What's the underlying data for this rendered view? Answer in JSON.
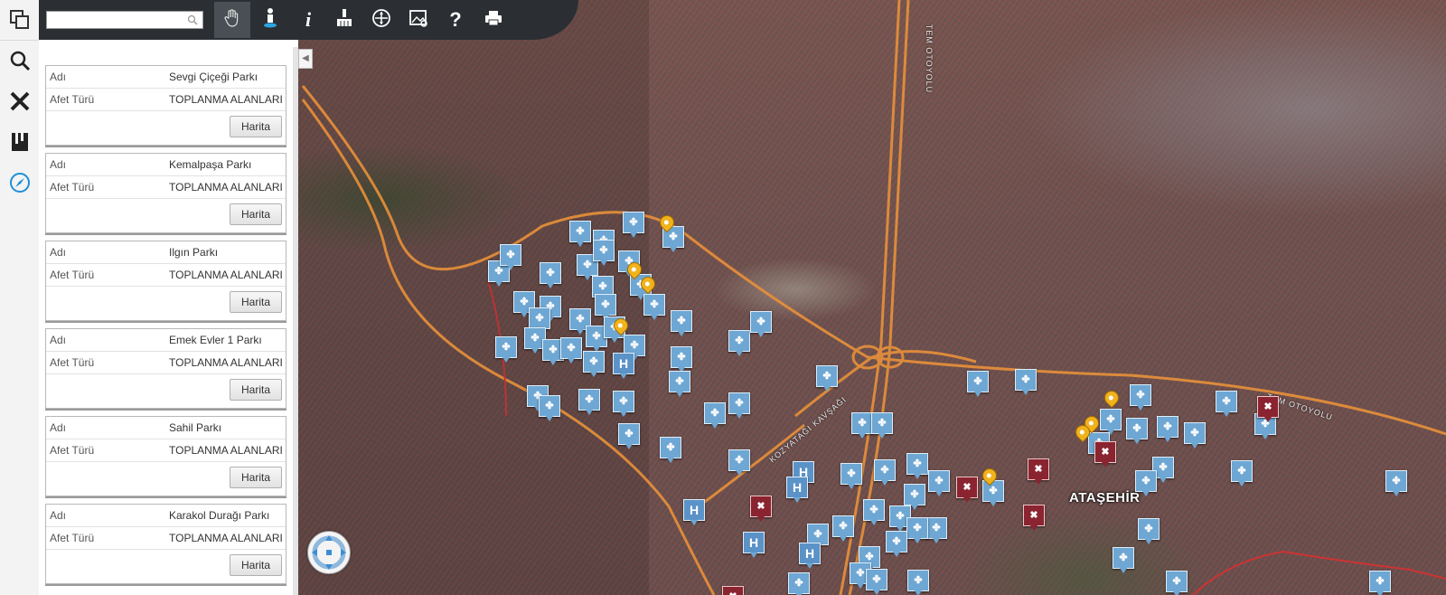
{
  "search": {
    "placeholder": "",
    "value": ""
  },
  "toolbar": {
    "tools": [
      {
        "icon": "hand-pan-icon",
        "active": true
      },
      {
        "icon": "street-view-icon",
        "active": false
      },
      {
        "icon": "info-icon",
        "label": "i",
        "active": false
      },
      {
        "icon": "brush-icon",
        "active": false
      },
      {
        "icon": "layers-icon",
        "active": false
      },
      {
        "icon": "image-icon",
        "active": false
      },
      {
        "icon": "help-icon",
        "label": "?",
        "active": false
      },
      {
        "icon": "print-icon",
        "active": false
      }
    ]
  },
  "sidebar_icons": [
    "copy-icon",
    "search-icon",
    "tools-icon",
    "library-icon",
    "compass-icon"
  ],
  "results": [
    {
      "name_label": "Adı",
      "name": "Sevgi Çiçeği Parkı",
      "type_label": "Afet Türü",
      "type": "TOPLANMA ALANLARI",
      "button": "Harita"
    },
    {
      "name_label": "Adı",
      "name": "Kemalpaşa Parkı",
      "type_label": "Afet Türü",
      "type": "TOPLANMA ALANLARI",
      "button": "Harita"
    },
    {
      "name_label": "Adı",
      "name": "Ilgın Parkı",
      "type_label": "Afet Türü",
      "type": "TOPLANMA ALANLARI",
      "button": "Harita"
    },
    {
      "name_label": "Adı",
      "name": "Emek Evler 1 Parkı",
      "type_label": "Afet Türü",
      "type": "TOPLANMA ALANLARI",
      "button": "Harita"
    },
    {
      "name_label": "Adı",
      "name": "Sahil Parkı",
      "type_label": "Afet Türü",
      "type": "TOPLANMA ALANLARI",
      "button": "Harita"
    },
    {
      "name_label": "Adı",
      "name": "Karakol Durağı Parkı",
      "type_label": "Afet Türü",
      "type": "TOPLANMA ALANLARI",
      "button": "Harita"
    }
  ],
  "map": {
    "district_label": "ATAŞEHİR",
    "road_labels": [
      "TEM OTOYOLU",
      "KOZYATAĞI KAVŞAĞI",
      "TEM OTOYOLU"
    ],
    "marker_types": [
      "assembly-area-marker",
      "hospital-marker",
      "repair-marker",
      "location-pin"
    ],
    "colors": {
      "assembly": "#6ea7d3",
      "repair": "#8a2430",
      "pin": "#f1b21c",
      "road": "#e8913a"
    }
  }
}
